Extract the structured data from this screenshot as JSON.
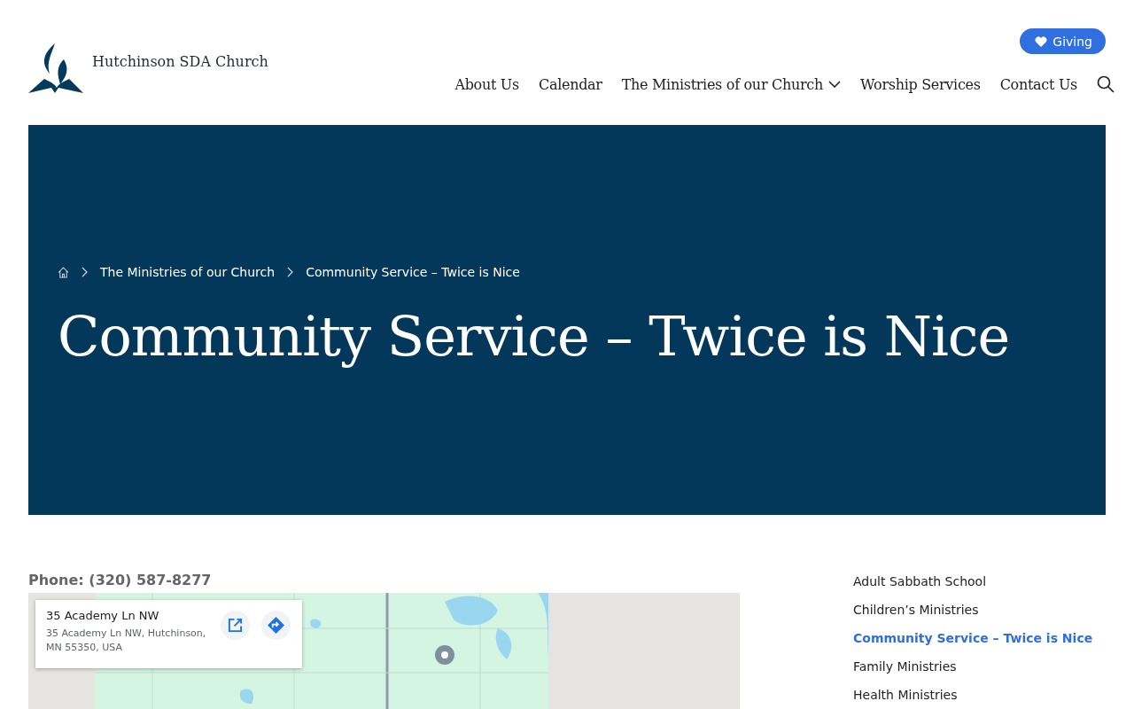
{
  "site": {
    "name": "Hutchinson SDA Church"
  },
  "giving_button": {
    "label": "Giving"
  },
  "nav": [
    {
      "label": "About Us",
      "kind": "link"
    },
    {
      "label": "Calendar",
      "kind": "link"
    },
    {
      "label": "The Ministries of our Church",
      "kind": "dropdown"
    },
    {
      "label": "Worship Services",
      "kind": "link"
    },
    {
      "label": "Contact Us",
      "kind": "link"
    }
  ],
  "breadcrumb": [
    "The Ministries of our Church",
    "Community Service – Twice is Nice"
  ],
  "page_title": "Community Service – Twice is Nice",
  "phone": "Phone: (320) 587-8277",
  "map_card": {
    "title": "35 Academy Ln NW",
    "address": "35 Academy Ln NW, Hutchinson, MN 55350, USA"
  },
  "side_menu": [
    {
      "label": "Adult Sabbath School",
      "selected": false
    },
    {
      "label": "Children’s Ministries",
      "selected": false
    },
    {
      "label": "Community Service – Twice is Nice",
      "selected": true
    },
    {
      "label": "Family Ministries",
      "selected": false
    },
    {
      "label": "Health Ministries",
      "selected": false
    }
  ]
}
